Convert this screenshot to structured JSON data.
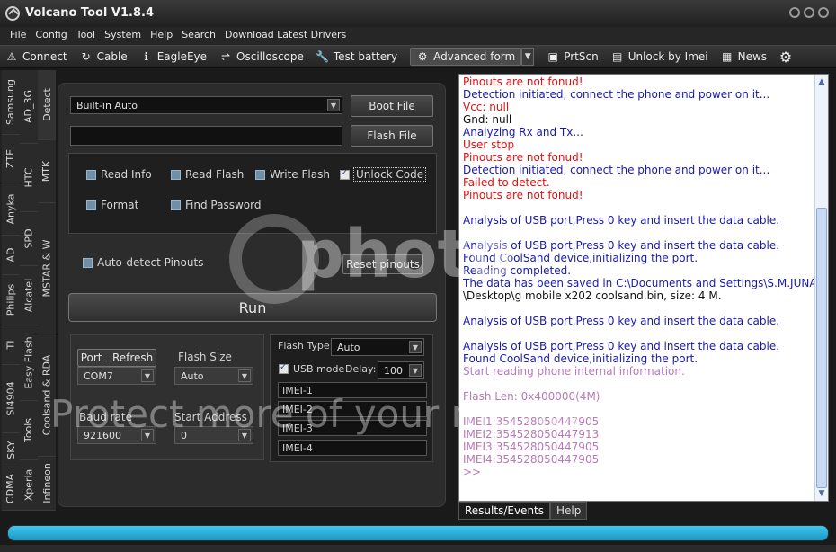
{
  "app": {
    "title": "Volcano Tool V1.8.4"
  },
  "menu": [
    "File",
    "Config",
    "Tool",
    "System",
    "Help",
    "Search",
    "Download Latest Drivers"
  ],
  "toolbar": {
    "connect": "Connect",
    "cable": "Cable",
    "eagleeye": "EagleEye",
    "oscilloscope": "Oscilloscope",
    "test_battery": "Test battery",
    "advanced_form": "Advanced form",
    "prtscn": "PrtScn",
    "unlock_by_imei": "Unlock by Imei",
    "news": "News"
  },
  "vertical_tabs": {
    "col1": [
      "Samsung",
      "ZTE",
      "Anyka",
      "AD",
      "Philips",
      "TI",
      "SI4904",
      "SKY",
      "CDMA"
    ],
    "col2": [
      "AD_3G",
      "HTC",
      "SPD",
      "Alcatel",
      "Easy Flash",
      "Tools",
      "Xperia"
    ],
    "col3": [
      "Detect",
      "MTK",
      "MSTAR & W",
      "Coolsand & RDA",
      "Infineon"
    ]
  },
  "main": {
    "mode_select": "Built-in Auto",
    "boot_file": "Boot File",
    "flash_file": "Flash File",
    "options": {
      "read_info": "Read Info",
      "read_flash": "Read Flash",
      "write_flash": "Write Flash",
      "unlock_code": "Unlock Code",
      "format": "Format",
      "find_password": "Find Password"
    },
    "auto_detect": "Auto-detect Pinouts",
    "reset_pinouts": "Reset pinouts",
    "run": "Run",
    "port_label": "Port",
    "refresh": "Refresh",
    "port_value": "COM7",
    "flash_size_label": "Flash Size",
    "flash_size_value": "Auto",
    "baud_rate_label": "Baud rate",
    "baud_rate_value": "921600",
    "start_address_label": "Start Address",
    "start_address_value": "0",
    "flash_type_label": "Flash Type:",
    "flash_type_value": "Auto",
    "usb_mode": "USB mode",
    "delay_label": "Delay:",
    "delay_value": "100",
    "imei": [
      "IMEI-1",
      "IMEI-2",
      "IMEI-3",
      "IMEI-4"
    ]
  },
  "log": {
    "lines": [
      {
        "text": "Pinouts are not fonud!",
        "color": "red"
      },
      {
        "text": "Detection initiated, connect the phone and power on it...",
        "color": "blue"
      },
      {
        "text": "Vcc: null",
        "color": "red"
      },
      {
        "text": "Gnd: null",
        "color": "black"
      },
      {
        "text": "Analyzing Rx and Tx...",
        "color": "blue"
      },
      {
        "text": "User stop",
        "color": "red"
      },
      {
        "text": "Pinouts are not fonud!",
        "color": "red"
      },
      {
        "text": "Detection initiated, connect the phone and power on it...",
        "color": "blue"
      },
      {
        "text": "Failed to detect.",
        "color": "red"
      },
      {
        "text": "Pinouts are not fonud!",
        "color": "red"
      },
      {
        "text": "",
        "color": "black"
      },
      {
        "text": "Analysis of USB port,Press 0 key and insert the data cable.",
        "color": "blue"
      },
      {
        "text": "",
        "color": "black"
      },
      {
        "text": "Analysis of USB port,Press 0 key and insert the data cable.",
        "color": "blue"
      },
      {
        "text": "Found CoolSand device,initializing the port.",
        "color": "blue"
      },
      {
        "text": "Reading completed.",
        "color": "blue"
      },
      {
        "text": "The data has been saved in C:\\Documents and Settings\\S.M.JUNAID",
        "color": "blue"
      },
      {
        "text": "\\Desktop\\g mobile x202 coolsand.bin, size: 4 M.",
        "color": "black"
      },
      {
        "text": "",
        "color": "black"
      },
      {
        "text": "Analysis of USB port,Press 0 key and insert the data cable.",
        "color": "blue"
      },
      {
        "text": "",
        "color": "black"
      },
      {
        "text": "Analysis of USB port,Press 0 key and insert the data cable.",
        "color": "blue"
      },
      {
        "text": "Found CoolSand device,initializing the port.",
        "color": "blue"
      },
      {
        "text": "Start reading phone internal information.",
        "color": "violet"
      },
      {
        "text": "",
        "color": "black"
      },
      {
        "text": "Flash Len: 0x400000(4M)",
        "color": "violet"
      },
      {
        "text": "",
        "color": "black"
      },
      {
        "text": "IMEI1:354528050447905",
        "color": "violet"
      },
      {
        "text": "IMEI2:354528050447913",
        "color": "violet"
      },
      {
        "text": "IMEI3:354528050447905",
        "color": "violet"
      },
      {
        "text": "IMEI4:354528050447905",
        "color": "violet"
      },
      {
        "text": ">>",
        "color": "violet"
      }
    ],
    "tabs": [
      "Results/Events",
      "Help"
    ]
  },
  "progress": 1.0,
  "watermark": {
    "photo_text": "photo",
    "protect_text": "Protect more of your memories for less!"
  },
  "colors": {
    "red": "#e01010",
    "blue": "#1a1aa8",
    "violet": "#b77ab7",
    "progress": "#2fb6e4"
  }
}
